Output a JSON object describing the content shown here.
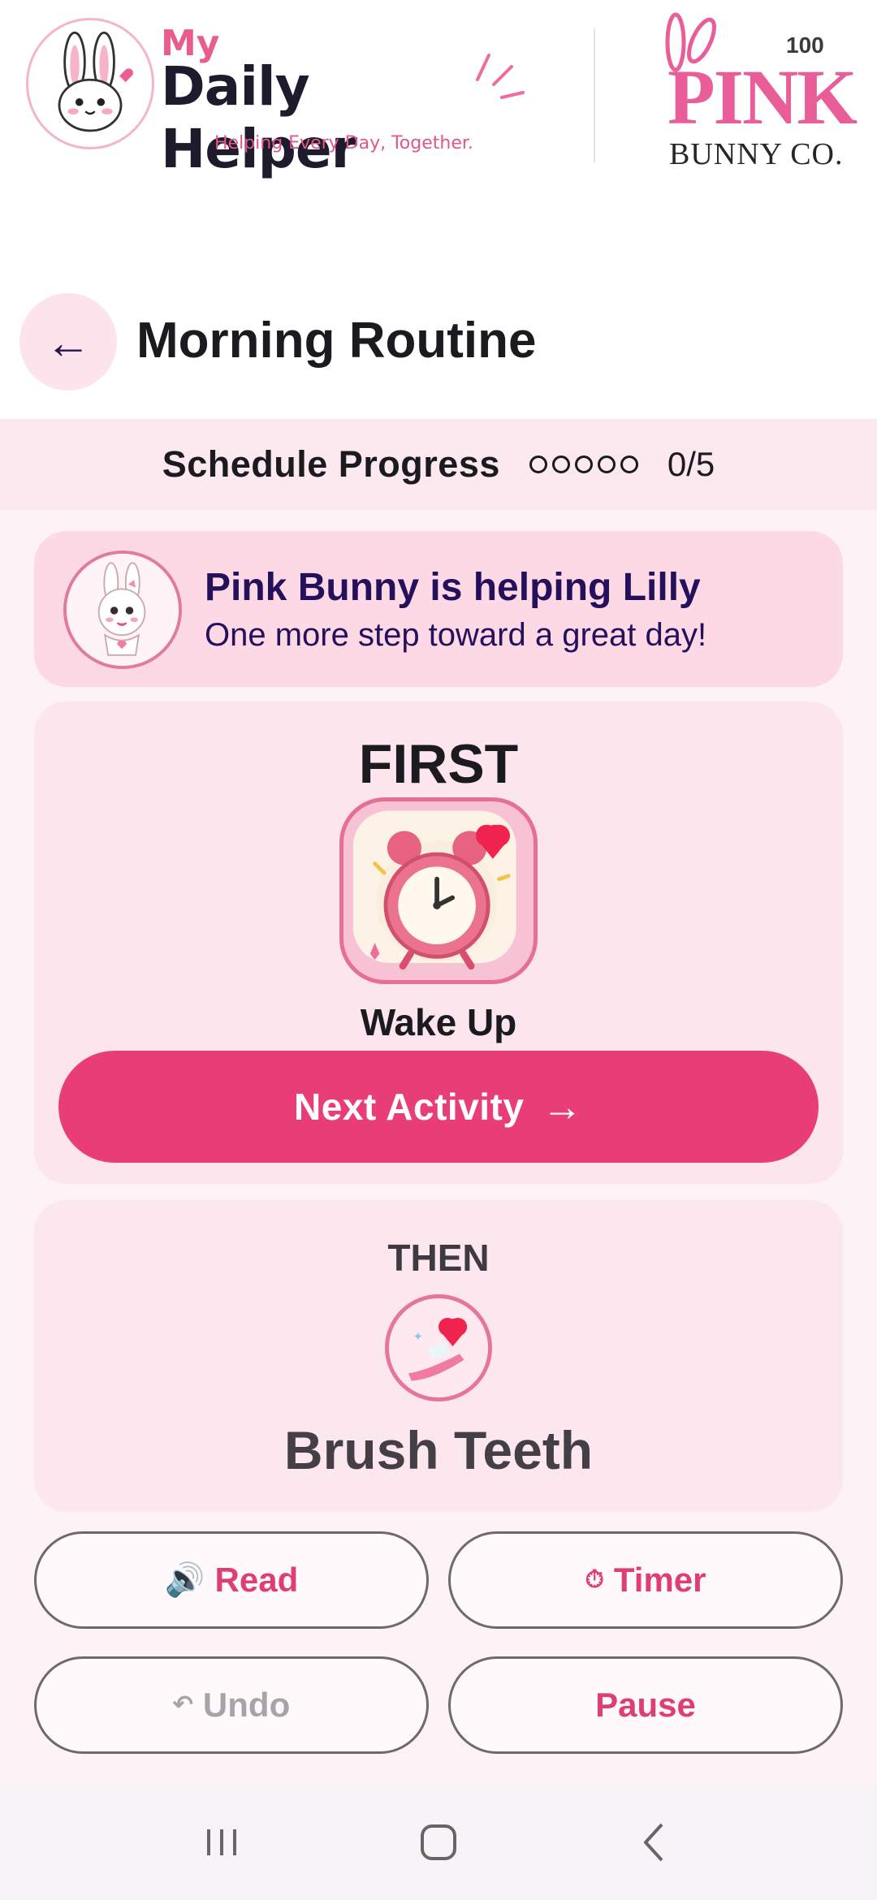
{
  "header": {
    "logo_my": "My",
    "logo_title": "Daily Helper",
    "logo_tagline": "Helping Every Day, Together.",
    "brand_number": "100",
    "brand_name": "PINK",
    "brand_sub": "BUNNY CO."
  },
  "page": {
    "back_icon": "arrow-left-icon",
    "title": "Morning Routine"
  },
  "progress": {
    "label": "Schedule Progress",
    "completed": 0,
    "total": 5,
    "count_text": "0/5"
  },
  "helper": {
    "title": "Pink Bunny is helping Lilly",
    "subtitle": "One more step toward a great day!"
  },
  "first": {
    "label": "FIRST",
    "activity": "Wake Up",
    "icon": "alarm-clock-icon",
    "next_button": "Next Activity",
    "next_arrow": "→"
  },
  "then": {
    "label": "THEN",
    "activity": "Brush Teeth",
    "icon": "toothbrush-icon"
  },
  "actions": {
    "read": {
      "label": "Read",
      "icon": "speaker-icon",
      "glyph": "🔊"
    },
    "timer": {
      "label": "Timer",
      "icon": "stopwatch-icon",
      "glyph": "⏱"
    },
    "undo": {
      "label": "Undo",
      "icon": "undo-icon",
      "glyph": "↶",
      "enabled": false
    },
    "pause": {
      "label": "Pause"
    }
  },
  "colors": {
    "accent": "#e93d77",
    "soft_pink": "#fde5ee",
    "helper_bg": "#fdd9e5",
    "progress_bg": "#fce8ef",
    "helper_text": "#25105c"
  }
}
